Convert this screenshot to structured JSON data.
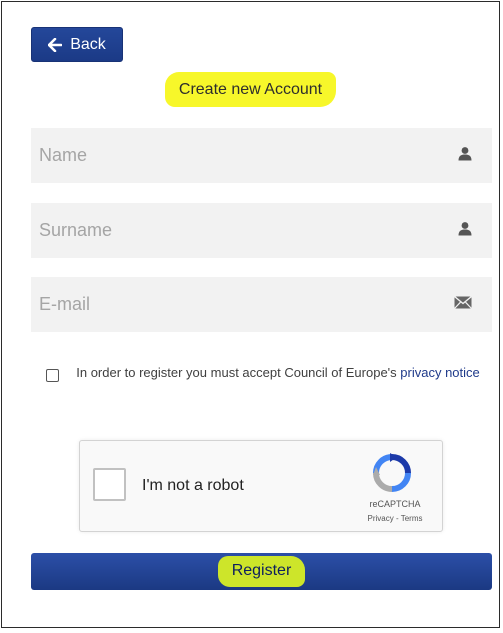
{
  "back": {
    "label": "Back"
  },
  "title": "Create new Account",
  "fields": {
    "name": {
      "placeholder": "Name",
      "value": ""
    },
    "surname": {
      "placeholder": "Surname",
      "value": ""
    },
    "email": {
      "placeholder": "E-mail",
      "value": ""
    }
  },
  "icons": {
    "name": "user-icon",
    "surname": "user-icon",
    "email": "envelope-icon",
    "back": "arrow-left-icon"
  },
  "consent": {
    "text": "In order to register you must accept Council of Europe's",
    "link": "privacy notice"
  },
  "captcha": {
    "label": "I'm not a robot",
    "brand": "reCAPTCHA",
    "terms": "Privacy - Terms"
  },
  "register": {
    "label": "Register"
  },
  "colors": {
    "primary": "#1f3f94",
    "highlight": "#f7f72a",
    "register_highlight": "#cde52a",
    "field_bg": "#f2f2f2"
  }
}
